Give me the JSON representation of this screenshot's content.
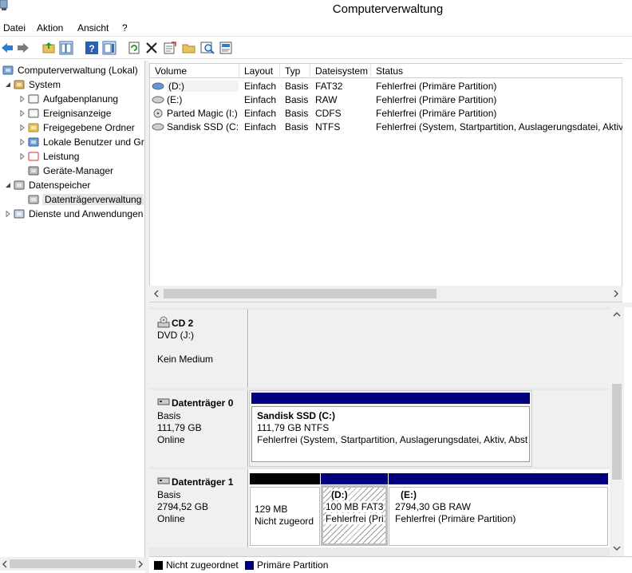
{
  "window": {
    "title": "Computerverwaltung"
  },
  "menu": [
    "Datei",
    "Aktion",
    "Ansicht",
    "?"
  ],
  "toolbar": [
    "back-arrow-icon",
    "forward-arrow-icon",
    "up-folder-icon",
    "show-hide-tree-icon",
    "help-icon",
    "action-pane-icon",
    "refresh-icon",
    "delete-icon",
    "open-icon",
    "folder-open-icon",
    "search-icon",
    "properties-icon"
  ],
  "tree": [
    {
      "label": "Computerverwaltung (Lokal)",
      "icon": "computer-management-icon",
      "indent": 0,
      "expander": ""
    },
    {
      "label": "System",
      "icon": "system-tools-icon",
      "indent": 1,
      "expander": "expanded"
    },
    {
      "label": "Aufgabenplanung",
      "icon": "task-scheduler-icon",
      "indent": 2,
      "expander": "collapsed"
    },
    {
      "label": "Ereignisanzeige",
      "icon": "event-viewer-icon",
      "indent": 2,
      "expander": "collapsed"
    },
    {
      "label": "Freigegebene Ordner",
      "icon": "shared-folders-icon",
      "indent": 2,
      "expander": "collapsed"
    },
    {
      "label": "Lokale Benutzer und Gru",
      "icon": "local-users-icon",
      "indent": 2,
      "expander": "collapsed"
    },
    {
      "label": "Leistung",
      "icon": "performance-icon",
      "indent": 2,
      "expander": "collapsed"
    },
    {
      "label": "Geräte-Manager",
      "icon": "device-manager-icon",
      "indent": 2,
      "expander": ""
    },
    {
      "label": "Datenspeicher",
      "icon": "storage-icon",
      "indent": 1,
      "expander": "expanded"
    },
    {
      "label": "Datenträgerverwaltung",
      "icon": "disk-management-icon",
      "indent": 2,
      "expander": "",
      "selected": true
    },
    {
      "label": "Dienste und Anwendungen",
      "icon": "services-icon",
      "indent": 1,
      "expander": "collapsed"
    }
  ],
  "columns": [
    "Volume",
    "Layout",
    "Typ",
    "Dateisystem",
    "Status"
  ],
  "volumes": [
    {
      "volume": "(D:)",
      "layout": "Einfach",
      "typ": "Basis",
      "fs": "FAT32",
      "status": "Fehlerfrei (Primäre Partition)",
      "icon": "volume-blue-icon"
    },
    {
      "volume": "(E:)",
      "layout": "Einfach",
      "typ": "Basis",
      "fs": "RAW",
      "status": "Fehlerfrei (Primäre Partition)",
      "icon": "volume-gray-icon"
    },
    {
      "volume": "Parted Magic (I:)",
      "layout": "Einfach",
      "typ": "Basis",
      "fs": "CDFS",
      "status": "Fehlerfrei (Primäre Partition)",
      "icon": "cd-volume-icon"
    },
    {
      "volume": "Sandisk SSD (C:)",
      "layout": "Einfach",
      "typ": "Basis",
      "fs": "NTFS",
      "status": "Fehlerfrei (System, Startpartition, Auslagerungsdatei, Aktiv,",
      "icon": "volume-gray-icon"
    }
  ],
  "disks": {
    "cd2": {
      "name": "CD 2",
      "type": "DVD (J:)",
      "state": "Kein Medium"
    },
    "disk0": {
      "name": "Datenträger 0",
      "type": "Basis",
      "size": "111,79 GB",
      "state": "Online",
      "partition": {
        "title": "Sandisk SSD  (C:)",
        "size": "111,79 GB NTFS",
        "status": "Fehlerfrei (System, Startpartition, Auslagerungsdatei, Aktiv, Abst"
      }
    },
    "disk1": {
      "name": "Datenträger 1",
      "type": "Basis",
      "size": "2794,52 GB",
      "state": "Online",
      "unalloc": {
        "size": "129 MB",
        "status": "Nicht zugeord"
      },
      "d": {
        "title": "(D:)",
        "size": "100 MB FAT3",
        "status": "Fehlerfrei (Pri"
      },
      "e": {
        "title": "(E:)",
        "size": "2794,30 GB RAW",
        "status": "Fehlerfrei (Primäre Partition)"
      }
    }
  },
  "legend": [
    {
      "label": "Nicht zugeordnet",
      "color": "#000000"
    },
    {
      "label": "Primäre Partition",
      "color": "#00007f"
    }
  ],
  "colors": {
    "primary": "#00007f",
    "unallocated": "#000000",
    "selection": "#cce8ff"
  }
}
